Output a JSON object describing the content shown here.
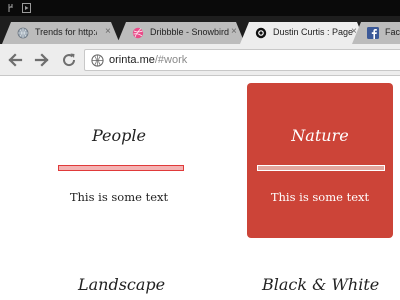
{
  "status_bar": {
    "icons": [
      "phone-usb-icon",
      "play-store-icon"
    ]
  },
  "tabs": [
    {
      "title": "Trends for http://",
      "favicon": "globe-icon",
      "active": false,
      "close": "×"
    },
    {
      "title": "Dribbble - Snowbird",
      "favicon": "dribbble-icon",
      "active": false,
      "close": "×"
    },
    {
      "title": "Dustin Curtis : Page",
      "favicon": "svbtle-icon",
      "active": true,
      "close": "×"
    },
    {
      "title": "Face",
      "favicon": "facebook-icon",
      "active": false,
      "close": ""
    }
  ],
  "toolbar": {
    "back_icon": "back-arrow-icon",
    "forward_icon": "forward-arrow-icon",
    "reload_icon": "reload-icon",
    "url_domain": "orinta.me",
    "url_path": "/#work"
  },
  "page": {
    "cards": [
      {
        "title": "People",
        "text": "This is some text",
        "highlighted": false
      },
      {
        "title": "Nature",
        "text": "This is some text",
        "highlighted": true
      }
    ],
    "sections": [
      "Landscape",
      "Black & White"
    ]
  },
  "colors": {
    "accent": "#cc4438",
    "tab_strip": "#1e1e1e",
    "toolbar": "#ededed",
    "status_bar": "#0a0a0a"
  }
}
